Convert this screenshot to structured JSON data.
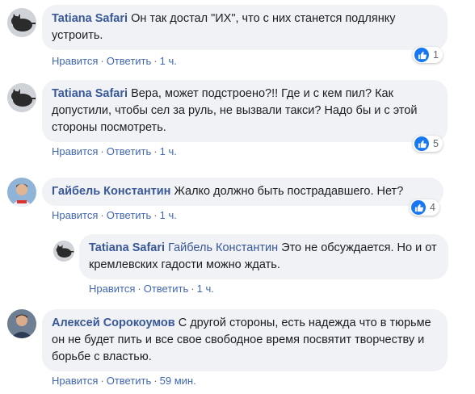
{
  "comments": [
    {
      "author": "Tatiana Safari",
      "text": "Он так достал \"ИХ\", что с них станется подлянку устроить.",
      "actions": {
        "like": "Нравится",
        "reply": "Ответить",
        "time": "1 ч."
      },
      "reactions": "1",
      "avatar_icon": "cat-avatar-icon"
    },
    {
      "author": "Tatiana Safari",
      "text": "Вера, может подстроено?!! Где и с кем пил? Как допустили, чтобы сел за руль, не вызвали такси? Надо бы и с этой стороны посмотреть.",
      "actions": {
        "like": "Нравится",
        "reply": "Ответить",
        "time": "1 ч."
      },
      "reactions": "5",
      "avatar_icon": "cat-avatar-icon"
    },
    {
      "author": "Гайбель Константин",
      "text": "Жалко должно быть пострадавшего. Нет?",
      "actions": {
        "like": "Нравится",
        "reply": "Ответить",
        "time": "1 ч."
      },
      "reactions": "4",
      "avatar_icon": "person-avatar-icon"
    },
    {
      "author": "Tatiana Safari",
      "mention": "Гайбель Константин",
      "text": "Это не обсуждается. Но и от кремлевских гадости можно ждать.",
      "actions": {
        "like": "Нравится",
        "reply": "Ответить",
        "time": "1 ч."
      },
      "avatar_icon": "cat-avatar-icon"
    },
    {
      "author": "Алексей Сорокоумов",
      "text": "С другой стороны, есть надежда что в тюрьме он не будет пить и все свое свободное время посвятит творчеству и борьбе с властью.",
      "actions": {
        "like": "Нравится",
        "reply": "Ответить",
        "time": "59 мин."
      },
      "avatar_icon": "person-avatar-icon"
    }
  ],
  "colors": {
    "bubble": "#f0f2f5",
    "author": "#385898",
    "link": "#4267b2",
    "like": "#1877f2"
  }
}
